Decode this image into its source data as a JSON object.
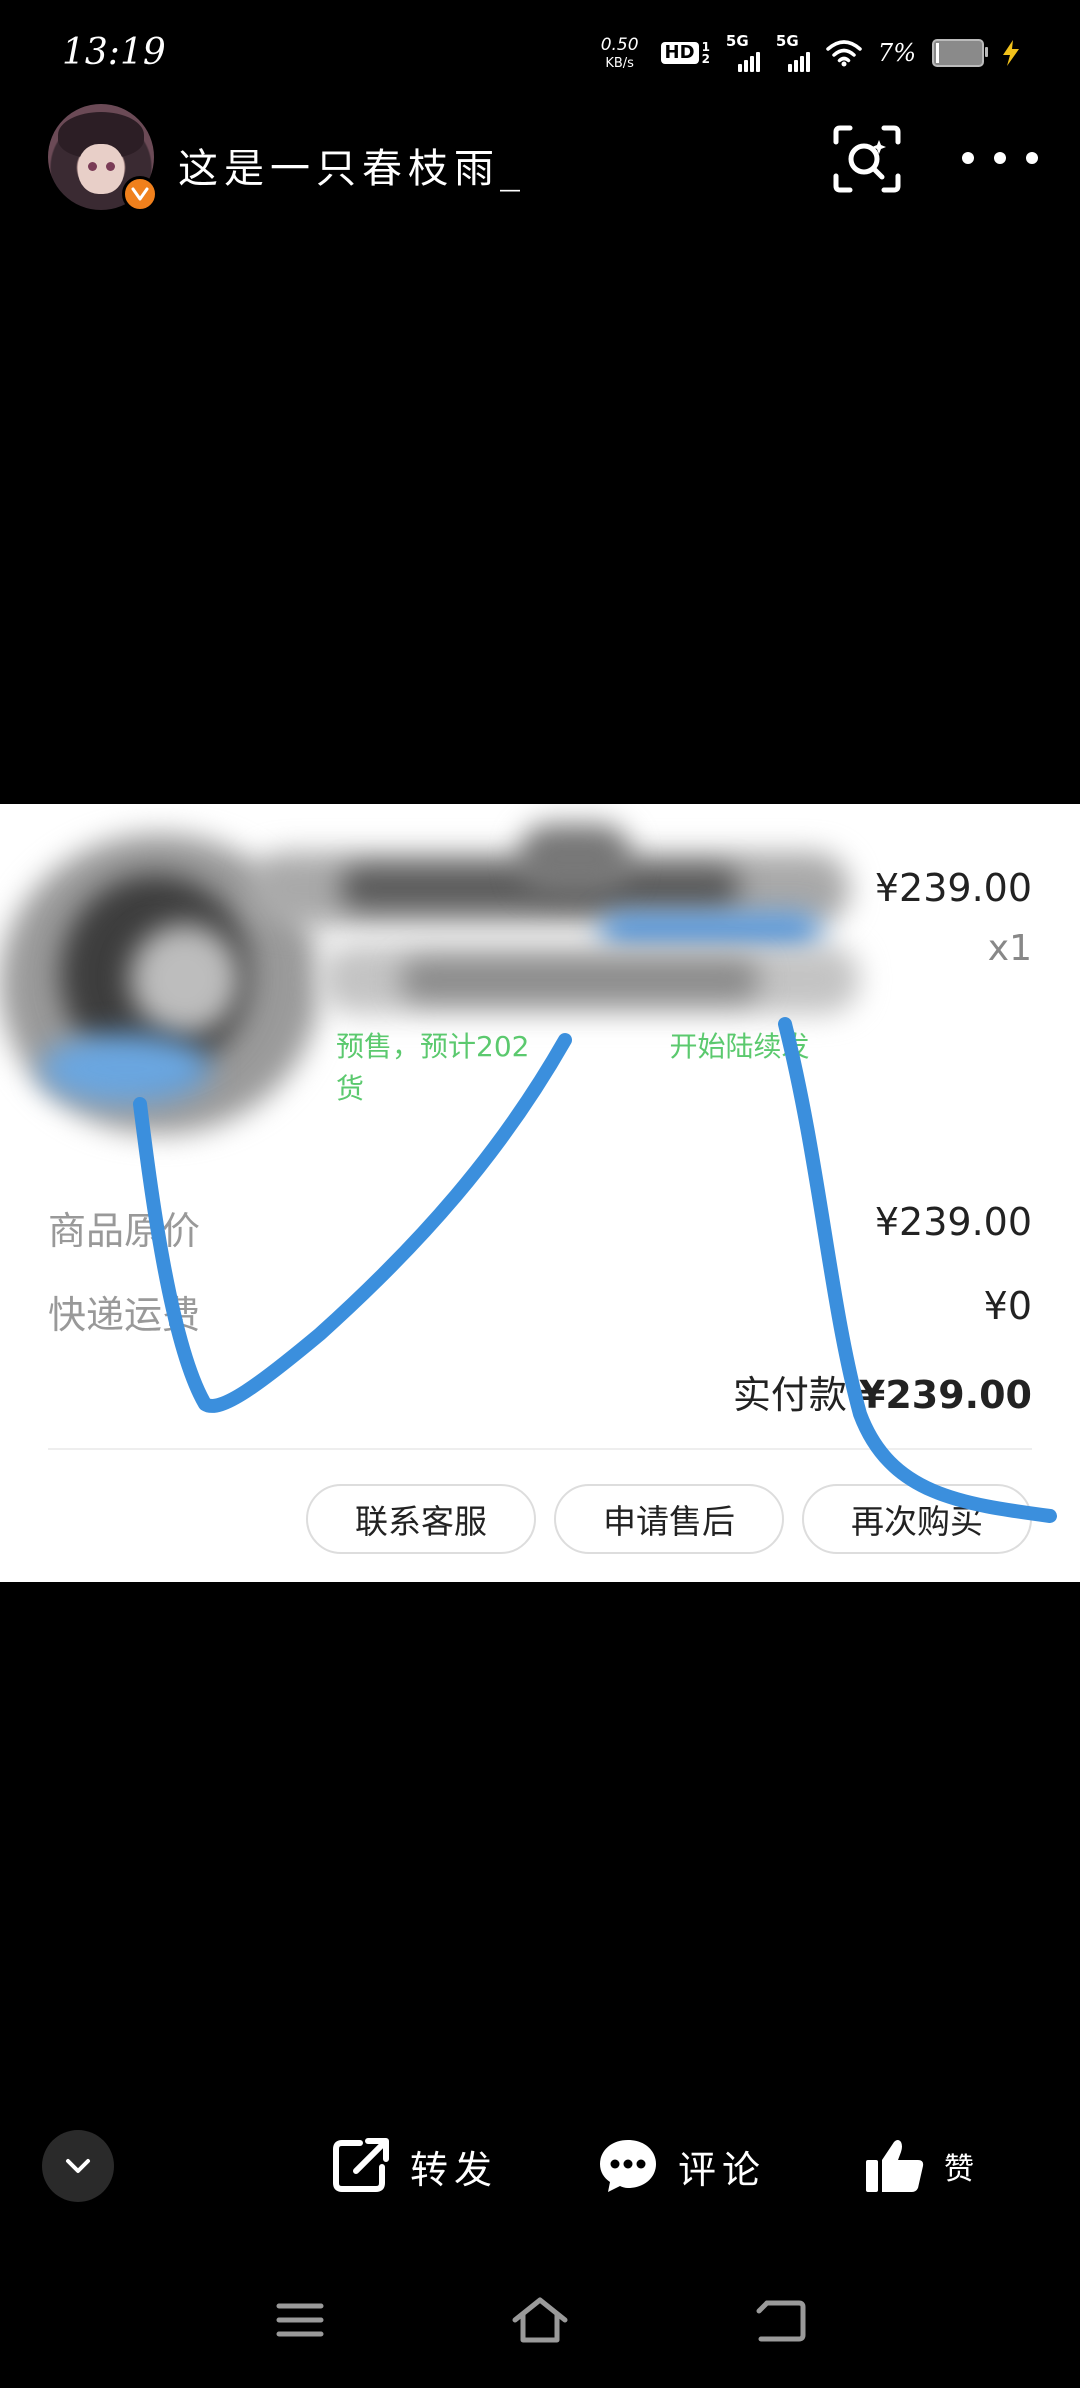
{
  "status_bar": {
    "time": "13:19",
    "net_speed_value": "0.50",
    "net_speed_unit": "KB/s",
    "hd_label": "HD",
    "hd_sub_top": "1",
    "hd_sub_bottom": "2",
    "sim1_label": "5G",
    "sim2_label": "5G",
    "battery_percent": "7%",
    "battery_level": 0.07,
    "charging": true
  },
  "header": {
    "username": "这是一只春枝雨_",
    "verified_badge_icon": "v-badge-icon",
    "badge_color": "#f0801c"
  },
  "order": {
    "unit_price": "¥239.00",
    "quantity": "x1",
    "notice_prefix": "预售，预计202",
    "notice_middle": "开始陆续发",
    "notice_suffix": "货",
    "original_price_label": "商品原价",
    "original_price_value": "¥239.00",
    "shipping_label": "快递运费",
    "shipping_value": "¥0",
    "paid_label": "实付款",
    "paid_value": "¥239.00",
    "buttons": {
      "contact_service": "联系客服",
      "after_sales": "申请售后",
      "buy_again": "再次购买"
    },
    "accent_green": "#5bc96e",
    "scribble_color": "#3b8fdd"
  },
  "action_bar": {
    "share_label": "转发",
    "comment_label": "评论",
    "like_label": "赞"
  }
}
